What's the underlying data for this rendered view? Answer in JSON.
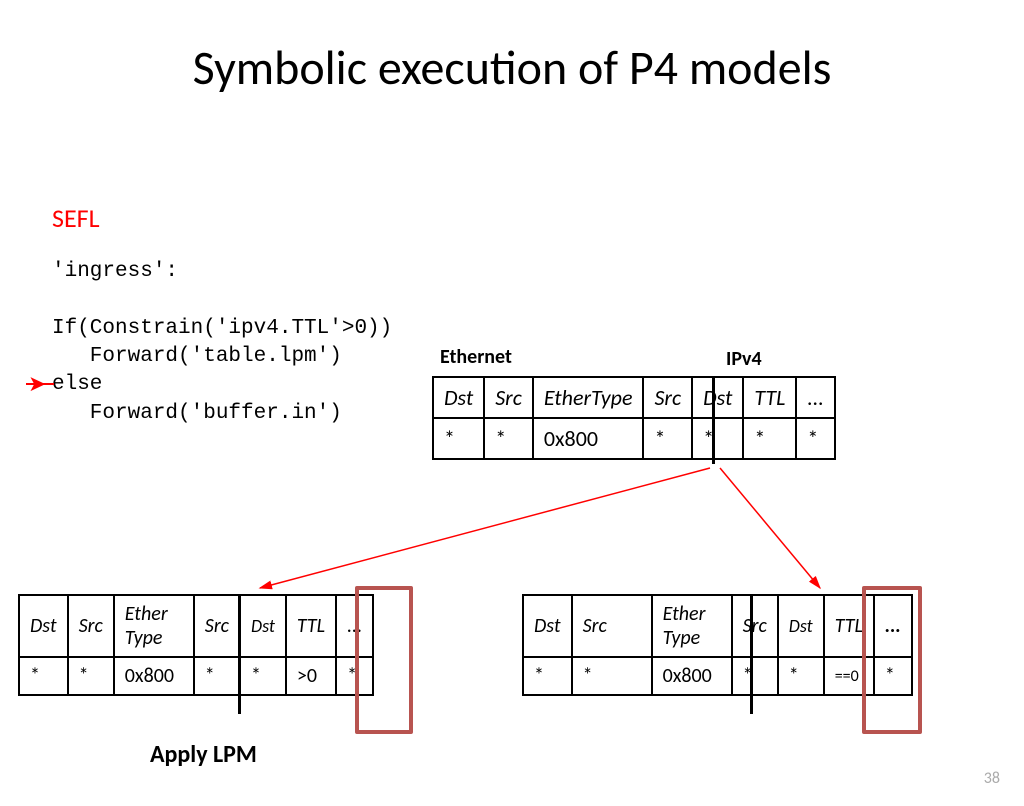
{
  "title": "Symbolic execution of P4 models",
  "sefl": "SEFL",
  "code": "'ingress':\n\nIf(Constrain('ipv4.TTL'>0))\n   Forward('table.lpm')\nelse\n   Forward('buffer.in')",
  "labels": {
    "ethernet": "Ethernet",
    "ipv4": "IPv4",
    "apply_lpm": "Apply LPM"
  },
  "top_table": {
    "headers": [
      "Dst",
      "Src",
      "EtherType",
      "Src",
      "Dst",
      "TTL",
      "..."
    ],
    "values": [
      "*",
      "*",
      "0x800",
      "*",
      "*",
      "*",
      "*"
    ]
  },
  "left_table": {
    "headers": [
      "Dst",
      "Src",
      "Ether Type",
      "Src",
      "Dst",
      "TTL",
      "..."
    ],
    "values": [
      "*",
      "*",
      "0x800",
      "*",
      "*",
      ">0",
      "*"
    ]
  },
  "right_table": {
    "headers": [
      "Dst",
      "Src",
      "Ether Type",
      "Src",
      "Dst",
      "TTL",
      "..."
    ],
    "values": [
      "*",
      "*",
      "0x800",
      "*",
      "*",
      "==0",
      "*"
    ]
  },
  "pagenum": "38"
}
